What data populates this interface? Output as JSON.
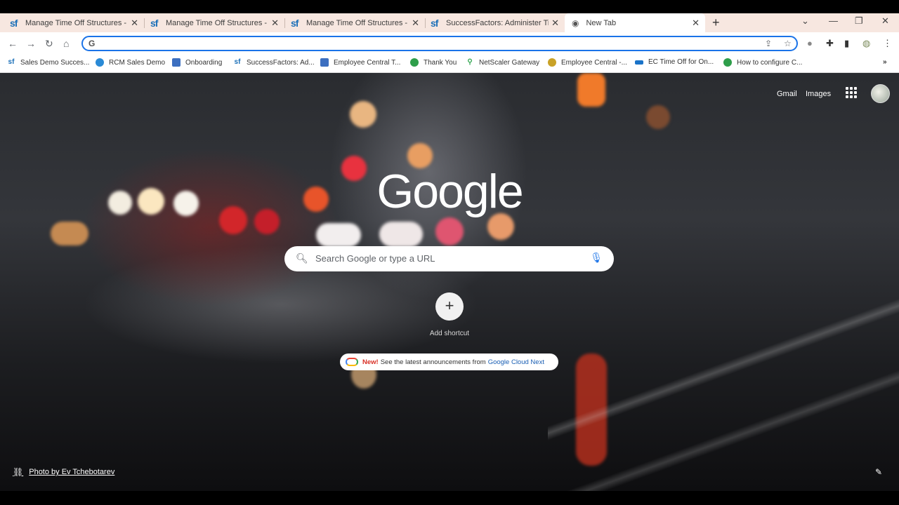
{
  "tabs": [
    {
      "icon": "sf",
      "title": "Manage Time Off Structures - Su"
    },
    {
      "icon": "sf",
      "title": "Manage Time Off Structures - Su"
    },
    {
      "icon": "sf",
      "title": "Manage Time Off Structures - Su"
    },
    {
      "icon": "sf",
      "title": "SuccessFactors: Administer Time"
    },
    {
      "icon": "chrome-icon",
      "title": "New Tab"
    }
  ],
  "omnibox": {
    "value": "",
    "g_letter": "G"
  },
  "bookmarks": [
    {
      "label": "Sales Demo Succes...",
      "icon": "sf"
    },
    {
      "label": "RCM Sales Demo",
      "icon": "cloud"
    },
    {
      "label": "Onboarding",
      "icon": "puzzle"
    },
    {
      "label": "SuccessFactors: Ad...",
      "icon": "sf"
    },
    {
      "label": "Employee Central T...",
      "icon": "puzzle"
    },
    {
      "label": "Thank You",
      "icon": "green-circle"
    },
    {
      "label": "NetScaler Gateway",
      "icon": "pin"
    },
    {
      "label": "Employee Central -...",
      "icon": "bulb"
    },
    {
      "label": "EC Time Off for On...",
      "icon": "sap"
    },
    {
      "label": "How to configure C...",
      "icon": "green-circle"
    }
  ],
  "google": {
    "gmail": "Gmail",
    "images": "Images",
    "logo": "Google",
    "search_placeholder": "Search Google or type a URL",
    "add_shortcut": "Add shortcut",
    "promo_new": "New!",
    "promo_text": "See the latest announcements from",
    "promo_link": "Google Cloud Next",
    "photo_credit": "Photo by Ev Tchebotarev"
  }
}
